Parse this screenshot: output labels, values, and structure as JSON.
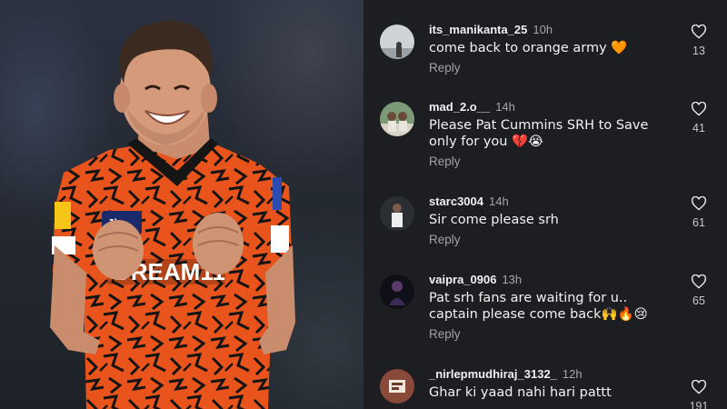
{
  "comments": [
    {
      "username": "its_manikanta_25",
      "time": "10h",
      "lines": [
        "come back to orange army 🧡"
      ],
      "reply": "Reply",
      "likes": "13"
    },
    {
      "username": "mad_2.o__",
      "time": "14h",
      "lines": [
        "Please Pat Cummins SRH to Save",
        "only for you 💔😭"
      ],
      "reply": "Reply",
      "likes": "41"
    },
    {
      "username": "starc3004",
      "time": "14h",
      "lines": [
        "Sir come please srh"
      ],
      "reply": "Reply",
      "likes": "61"
    },
    {
      "username": "vaipra_0906",
      "time": "13h",
      "lines": [
        "Pat srh fans are waiting for u..",
        "captain please come back🙌🔥😢"
      ],
      "reply": "Reply",
      "likes": "65"
    },
    {
      "username": "_nirlepmudhiraj_3132_",
      "time": "12h",
      "lines": [
        "Ghar ki yaad nahi hari pattt"
      ],
      "reply": "",
      "likes": "191"
    }
  ],
  "jersey": {
    "sponsor": "DREAM11",
    "left_patch": "Jio",
    "right_patch": "Jio",
    "primary_color": "#e8541b",
    "pattern_color": "#121212"
  },
  "icons": {
    "like": "heart-outline-icon"
  }
}
